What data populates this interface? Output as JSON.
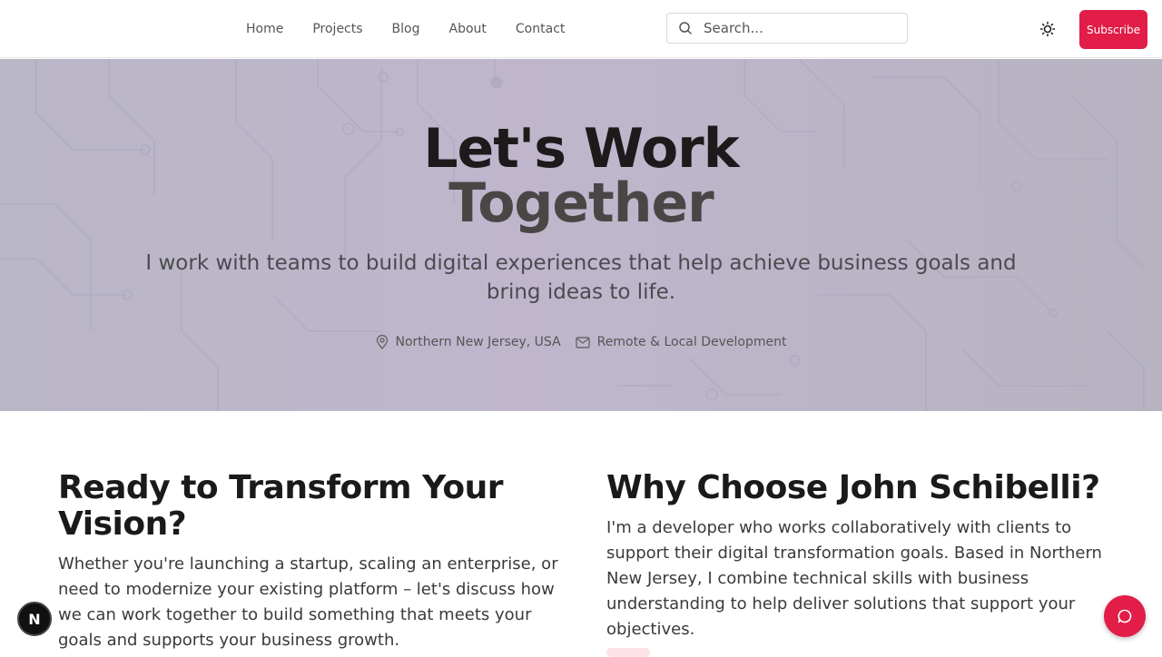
{
  "nav": {
    "items": [
      "Home",
      "Projects",
      "Blog",
      "About",
      "Contact"
    ]
  },
  "search": {
    "placeholder": "Search..."
  },
  "header": {
    "subscribe_label": "Subscribe",
    "theme_icon": "sun-icon"
  },
  "hero": {
    "title_line1": "Let's Work",
    "title_line2": "Together",
    "subtitle": "I work with teams to build digital experiences that help achieve business goals and bring ideas to life.",
    "location": "Northern New Jersey, USA",
    "work_mode": "Remote & Local Development"
  },
  "left": {
    "heading": "Ready to Transform Your Vision?",
    "text": "Whether you're launching a startup, scaling an enterprise, or need to modernize your existing platform – let's discuss how we can work together to build something that meets your goals and supports your business growth."
  },
  "right": {
    "heading": "Why Choose John Schibelli?",
    "text": "I'm a developer who works collaboratively with clients to support their digital transformation goals. Based in Northern New Jersey, I combine technical skills with business understanding to help deliver solutions that support your objectives."
  },
  "badge": {
    "label": "N"
  },
  "colors": {
    "accent": "#e11d48",
    "hero_bg": "#bcb6c8"
  }
}
